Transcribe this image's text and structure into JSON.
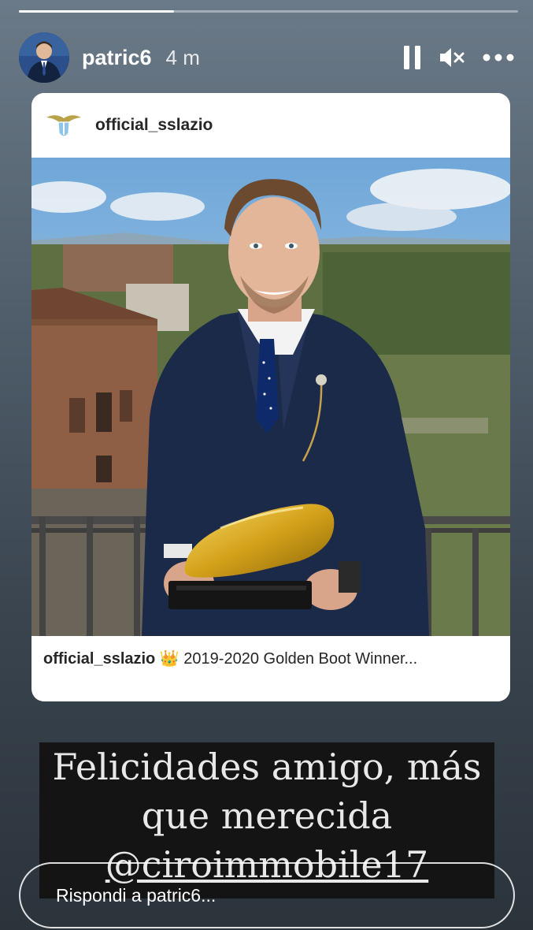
{
  "story": {
    "progress": 0.31,
    "username": "patric6",
    "time": "4 m"
  },
  "shared_post": {
    "account": "official_sslazio",
    "caption_account": "official_sslazio",
    "caption_emoji": "👑",
    "caption_text": " 2019-2020 Golden Boot Winner..."
  },
  "overlay": {
    "line1": "Felicidades amigo, más",
    "line2": "que merecida",
    "line3": "@ciroimmobile17"
  },
  "reply": {
    "placeholder": "Rispondi a patric6..."
  },
  "icons": {
    "pause": "pause-icon",
    "mute": "muted-speaker-icon",
    "more": "more-options-icon"
  },
  "colors": {
    "accent_white": "#ffffff",
    "lazio_blue": "#8ec5e8",
    "gold": "#d4a21a"
  }
}
